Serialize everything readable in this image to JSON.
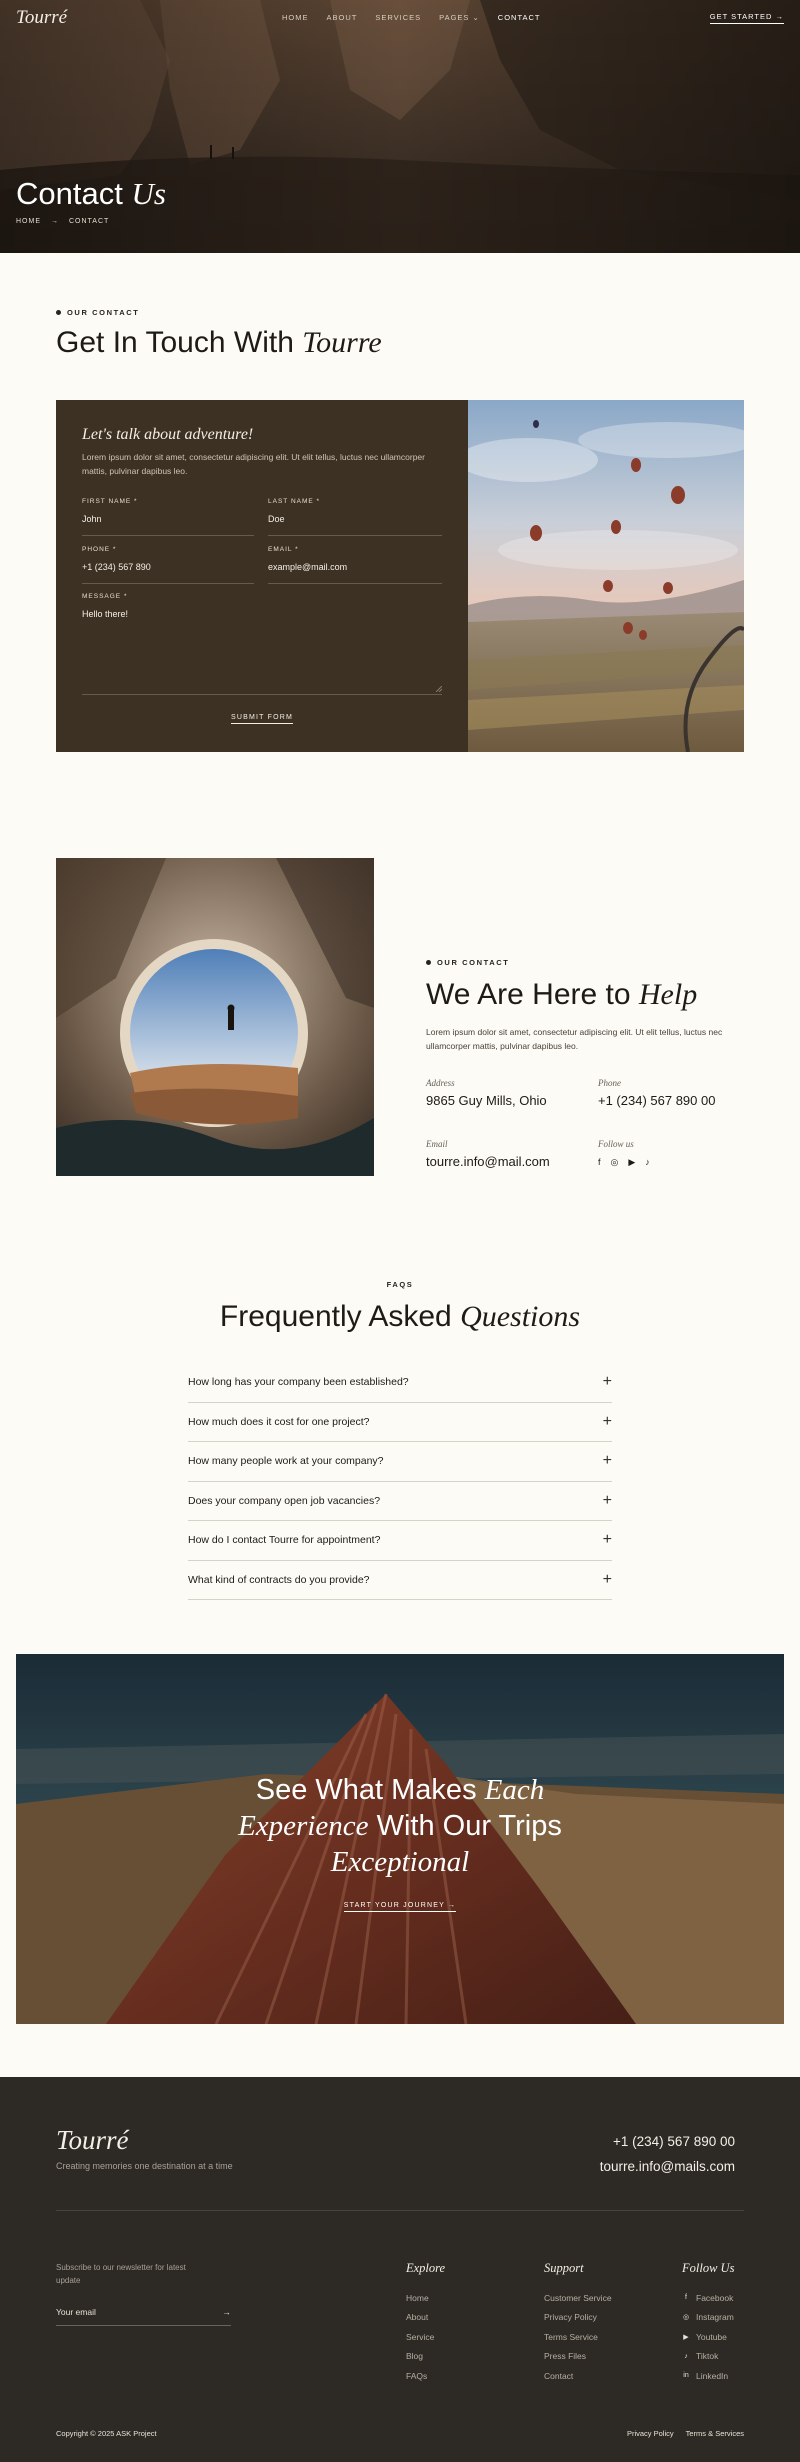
{
  "nav": {
    "logo": "Tourré",
    "links": [
      "HOME",
      "ABOUT",
      "SERVICES",
      "PAGES ⌄",
      "CONTACT"
    ],
    "cta": "GET STARTED →"
  },
  "hero": {
    "title_plain": "Contact",
    "title_italic": "Us",
    "crumb_home": "HOME",
    "crumb_arrow": "→",
    "crumb_current": "CONTACT"
  },
  "intro": {
    "eyebrow": "OUR CONTACT",
    "title_plain": "Get In Touch With",
    "title_italic": "Tourre"
  },
  "form": {
    "heading": "Let's talk about adventure!",
    "lead": "Lorem ipsum dolor sit amet, consectetur adipiscing elit. Ut elit tellus, luctus nec ullamcorper mattis, pulvinar dapibus leo.",
    "first_name_label": "FIRST NAME *",
    "first_name_value": "John",
    "last_name_label": "LAST NAME *",
    "last_name_value": "Doe",
    "phone_label": "PHONE *",
    "phone_value": "+1 (234) 567 890",
    "email_label": "EMAIL *",
    "email_value": "example@mail.com",
    "message_label": "MESSAGE *",
    "message_value": "Hello there!",
    "submit": "SUBMIT FORM"
  },
  "help": {
    "eyebrow": "OUR CONTACT",
    "title_plain": "We Are Here to",
    "title_italic": "Help",
    "lead": "Lorem ipsum dolor sit amet, consectetur adipiscing elit. Ut elit tellus, luctus nec ullamcorper mattis, pulvinar dapibus leo.",
    "address_label": "Address",
    "address_value": "9865 Guy Mills, Ohio",
    "phone_label": "Phone",
    "phone_value": "+1 (234) 567 890 00",
    "email_label": "Email",
    "email_value": "tourre.info@mail.com",
    "follow_label": "Follow us"
  },
  "faq": {
    "eyebrow": "FAQS",
    "title_plain": "Frequently Asked",
    "title_italic": "Questions",
    "items": [
      "How long has your company been established?",
      "How much does it cost for one project?",
      "How many people work at your company?",
      "Does your company open job vacancies?",
      "How do I contact Tourre for appointment?",
      "What kind of contracts do you provide?"
    ]
  },
  "cta": {
    "line1_plain": "See What Makes",
    "line1_italic": "Each",
    "line2_italic": "Experience",
    "line2_plain": "With Our Trips",
    "line3_italic": "Exceptional",
    "link": "START YOUR JOURNEY →"
  },
  "footer": {
    "logo": "Tourré",
    "tagline": "Creating memories one destination at a time",
    "phone": "+1 (234) 567 890 00",
    "email": "tourre.info@mails.com",
    "newsletter": "Subscribe to our newsletter for latest update",
    "email_placeholder": "Your email",
    "email_arrow": "→",
    "explore_title": "Explore",
    "explore": [
      "Home",
      "About",
      "Service",
      "Blog",
      "FAQs"
    ],
    "support_title": "Support",
    "support": [
      "Customer Service",
      "Privacy Policy",
      "Terms Service",
      "Press Files",
      "Contact"
    ],
    "follow_title": "Follow Us",
    "follow": [
      "Facebook",
      "Instagram",
      "Youtube",
      "Tiktok",
      "LinkedIn"
    ],
    "copyright": "Copyright © 2025 ASK Project",
    "privacy": "Privacy Policy",
    "terms": "Terms & Services"
  },
  "colors": {
    "background": "#fcfbf6",
    "form_panel": "#3d3124",
    "footer": "#2d2924",
    "text_dark": "#1f1a14"
  }
}
